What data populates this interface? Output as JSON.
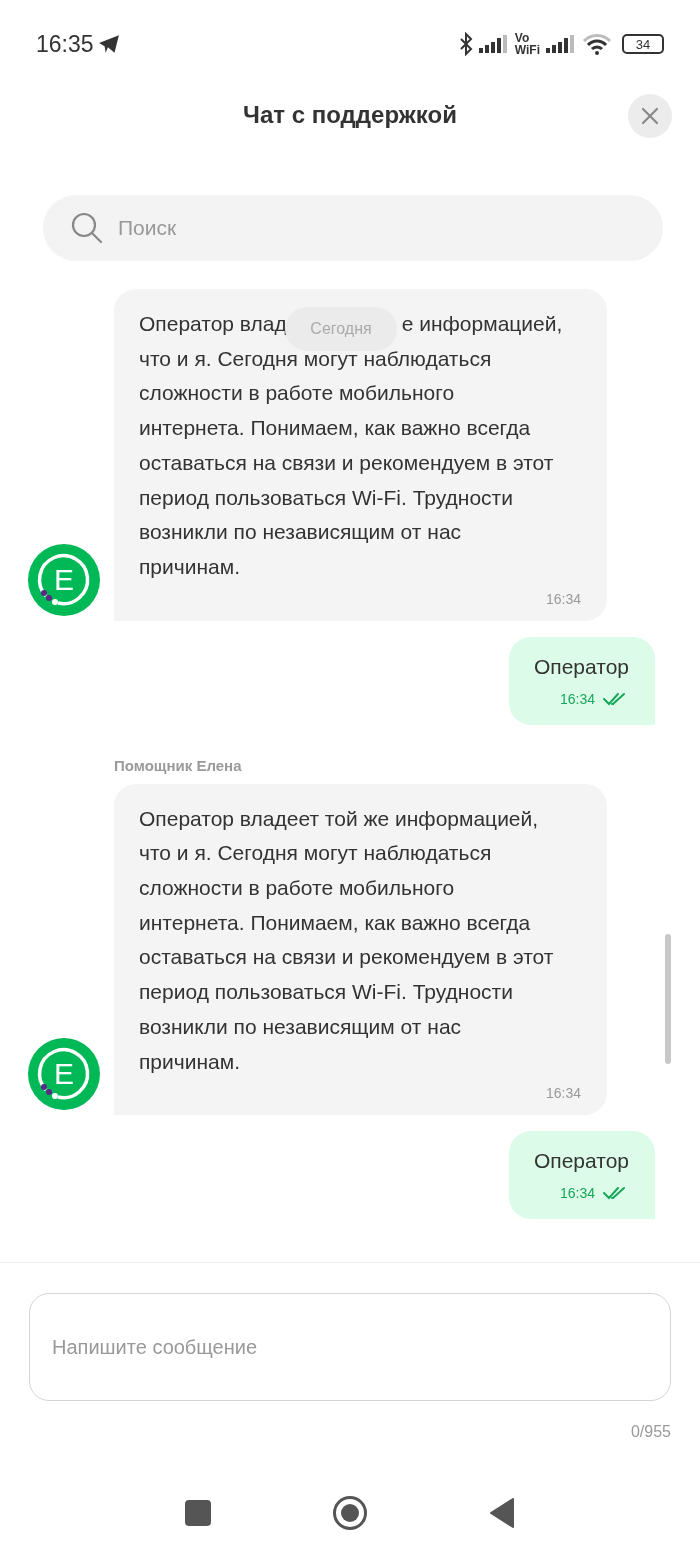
{
  "status_bar": {
    "time": "16:35",
    "vowifi_top": "Vo",
    "vowifi_bottom": "WiFi",
    "battery": "34"
  },
  "header": {
    "title": "Чат с поддержкой"
  },
  "search": {
    "placeholder": "Поиск"
  },
  "date_chip": "Сегодня",
  "messages": [
    {
      "kind": "incoming",
      "avatar_letter": "Е",
      "first_line_parts": [
        "Оператор влад",
        "е информацией,"
      ],
      "lines": [
        "что и я. Сегодня могут наблюдаться",
        "сложности в работе мобильного",
        "интернета. Понимаем, как важно всегда",
        "оставаться на связи и рекомендуем в этот",
        "период пользоваться Wi-Fi. Трудности",
        "возникли по независящим от нас",
        "причинам."
      ],
      "time": "16:34"
    },
    {
      "kind": "outgoing",
      "text": "Оператор",
      "time": "16:34",
      "read": true
    },
    {
      "kind": "incoming",
      "sender": "Помощник Елена",
      "avatar_letter": "Е",
      "lines": [
        "Оператор владеет той же информацией,",
        "что и я. Сегодня могут наблюдаться",
        "сложности в работе мобильного",
        "интернета. Понимаем, как важно всегда",
        "оставаться на связи и рекомендуем в этот",
        "период пользоваться Wi-Fi. Трудности",
        "возникли по независящим от нас",
        "причинам."
      ],
      "time": "16:34"
    },
    {
      "kind": "outgoing",
      "text": "Оператор",
      "time": "16:34",
      "read": true
    }
  ],
  "composer": {
    "placeholder": "Напишите сообщение",
    "counter": "0/955"
  }
}
